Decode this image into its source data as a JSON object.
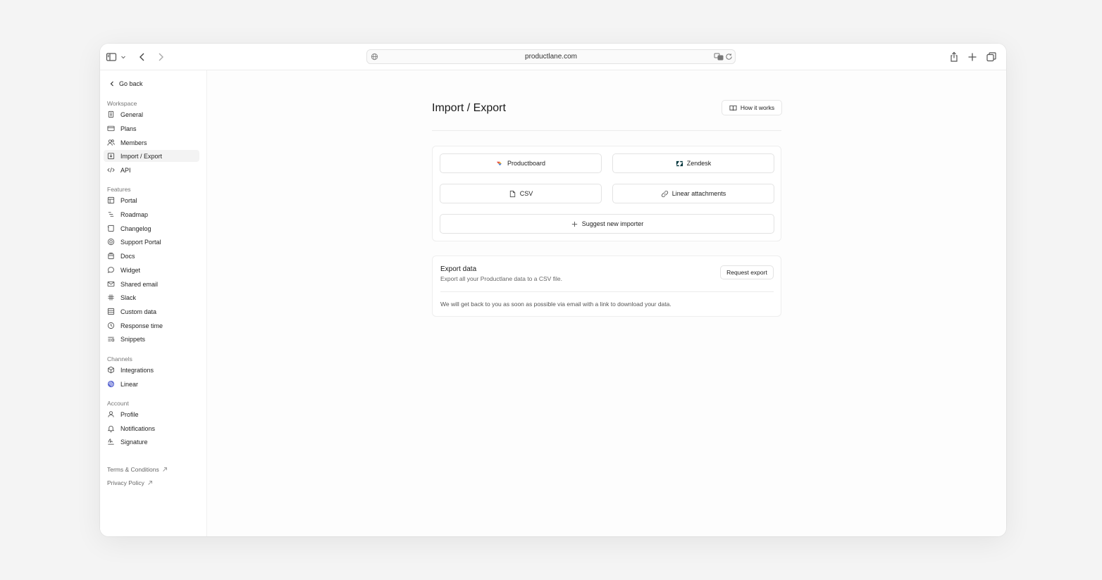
{
  "browser": {
    "url": "productlane.com"
  },
  "sidebar": {
    "go_back": "Go back",
    "sections": [
      {
        "label": "Workspace",
        "items": [
          {
            "label": "General",
            "icon": "building-icon"
          },
          {
            "label": "Plans",
            "icon": "credit-card-icon"
          },
          {
            "label": "Members",
            "icon": "users-icon"
          },
          {
            "label": "Import / Export",
            "icon": "import-export-icon",
            "active": true
          },
          {
            "label": "API",
            "icon": "code-icon"
          }
        ]
      },
      {
        "label": "Features",
        "items": [
          {
            "label": "Portal",
            "icon": "layout-icon"
          },
          {
            "label": "Roadmap",
            "icon": "roadmap-icon"
          },
          {
            "label": "Changelog",
            "icon": "scroll-icon"
          },
          {
            "label": "Support Portal",
            "icon": "lifebuoy-icon"
          },
          {
            "label": "Docs",
            "icon": "docs-icon"
          },
          {
            "label": "Widget",
            "icon": "chat-bubble-icon"
          },
          {
            "label": "Shared email",
            "icon": "mail-icon"
          },
          {
            "label": "Slack",
            "icon": "slack-icon"
          },
          {
            "label": "Custom data",
            "icon": "database-icon"
          },
          {
            "label": "Response time",
            "icon": "clock-icon"
          },
          {
            "label": "Snippets",
            "icon": "snippets-icon"
          }
        ]
      },
      {
        "label": "Channels",
        "items": [
          {
            "label": "Integrations",
            "icon": "cube-icon"
          },
          {
            "label": "Linear",
            "icon": "linear-logo-icon"
          }
        ]
      },
      {
        "label": "Account",
        "items": [
          {
            "label": "Profile",
            "icon": "user-icon"
          },
          {
            "label": "Notifications",
            "icon": "bell-icon"
          },
          {
            "label": "Signature",
            "icon": "signature-icon"
          }
        ]
      }
    ],
    "footer": {
      "terms": "Terms & Conditions",
      "privacy": "Privacy Policy"
    }
  },
  "main": {
    "title": "Import / Export",
    "how_it_works": "How it works",
    "importers": {
      "productboard": "Productboard",
      "zendesk": "Zendesk",
      "csv": "CSV",
      "linear_attachments": "Linear attachments",
      "suggest": "Suggest new importer"
    },
    "export": {
      "title": "Export data",
      "description": "Export all your Productlane data to a CSV file.",
      "button": "Request export",
      "note": "We will get back to you as soon as possible via email with a link to download your data."
    }
  },
  "colors": {
    "productboard_red": "#e8433f",
    "productboard_blue": "#3f7ce0",
    "productboard_yellow": "#f5b12c",
    "zendesk": "#03363d",
    "linear": "#5e6ad2"
  }
}
